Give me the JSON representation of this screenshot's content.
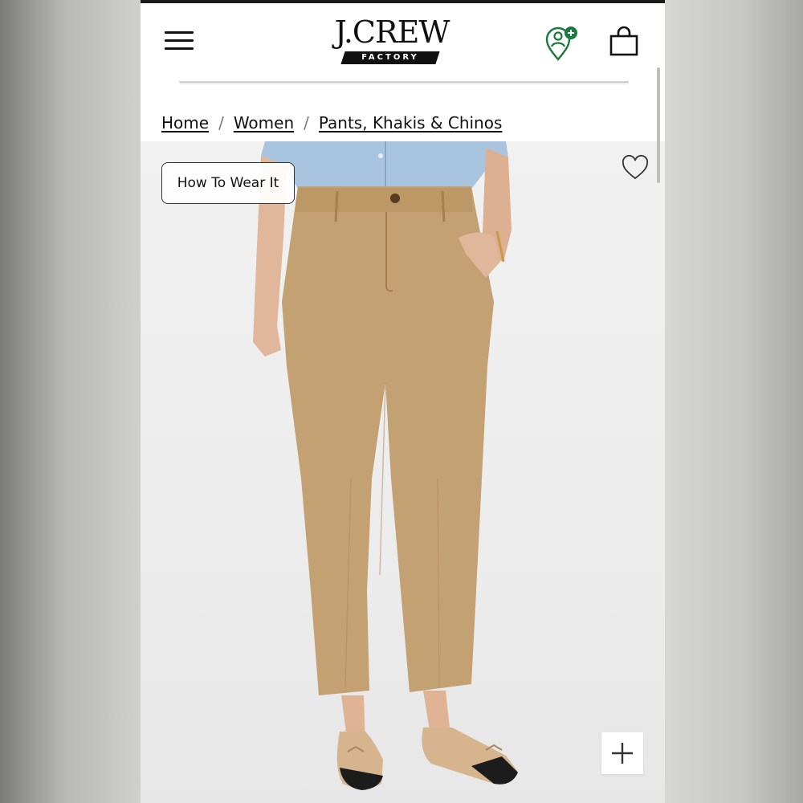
{
  "header": {
    "logo_text": "J.CREW",
    "logo_subtext": "FACTORY",
    "menu_icon": "hamburger-menu-icon",
    "location_icon": "store-location-icon",
    "bag_icon": "shopping-bag-icon"
  },
  "breadcrumb": {
    "items": [
      {
        "label": "Home"
      },
      {
        "label": "Women"
      },
      {
        "label": "Pants, Khakis & Chinos"
      }
    ],
    "separator": "/"
  },
  "product_image": {
    "how_to_wear_label": "How To Wear It",
    "favorite_icon": "heart-icon",
    "zoom_icon": "plus-icon"
  },
  "colors": {
    "brand_black": "#111111",
    "location_accent": "#1a7a3c",
    "khaki": "#c4a173",
    "denim_shirt": "#a9c4de"
  }
}
